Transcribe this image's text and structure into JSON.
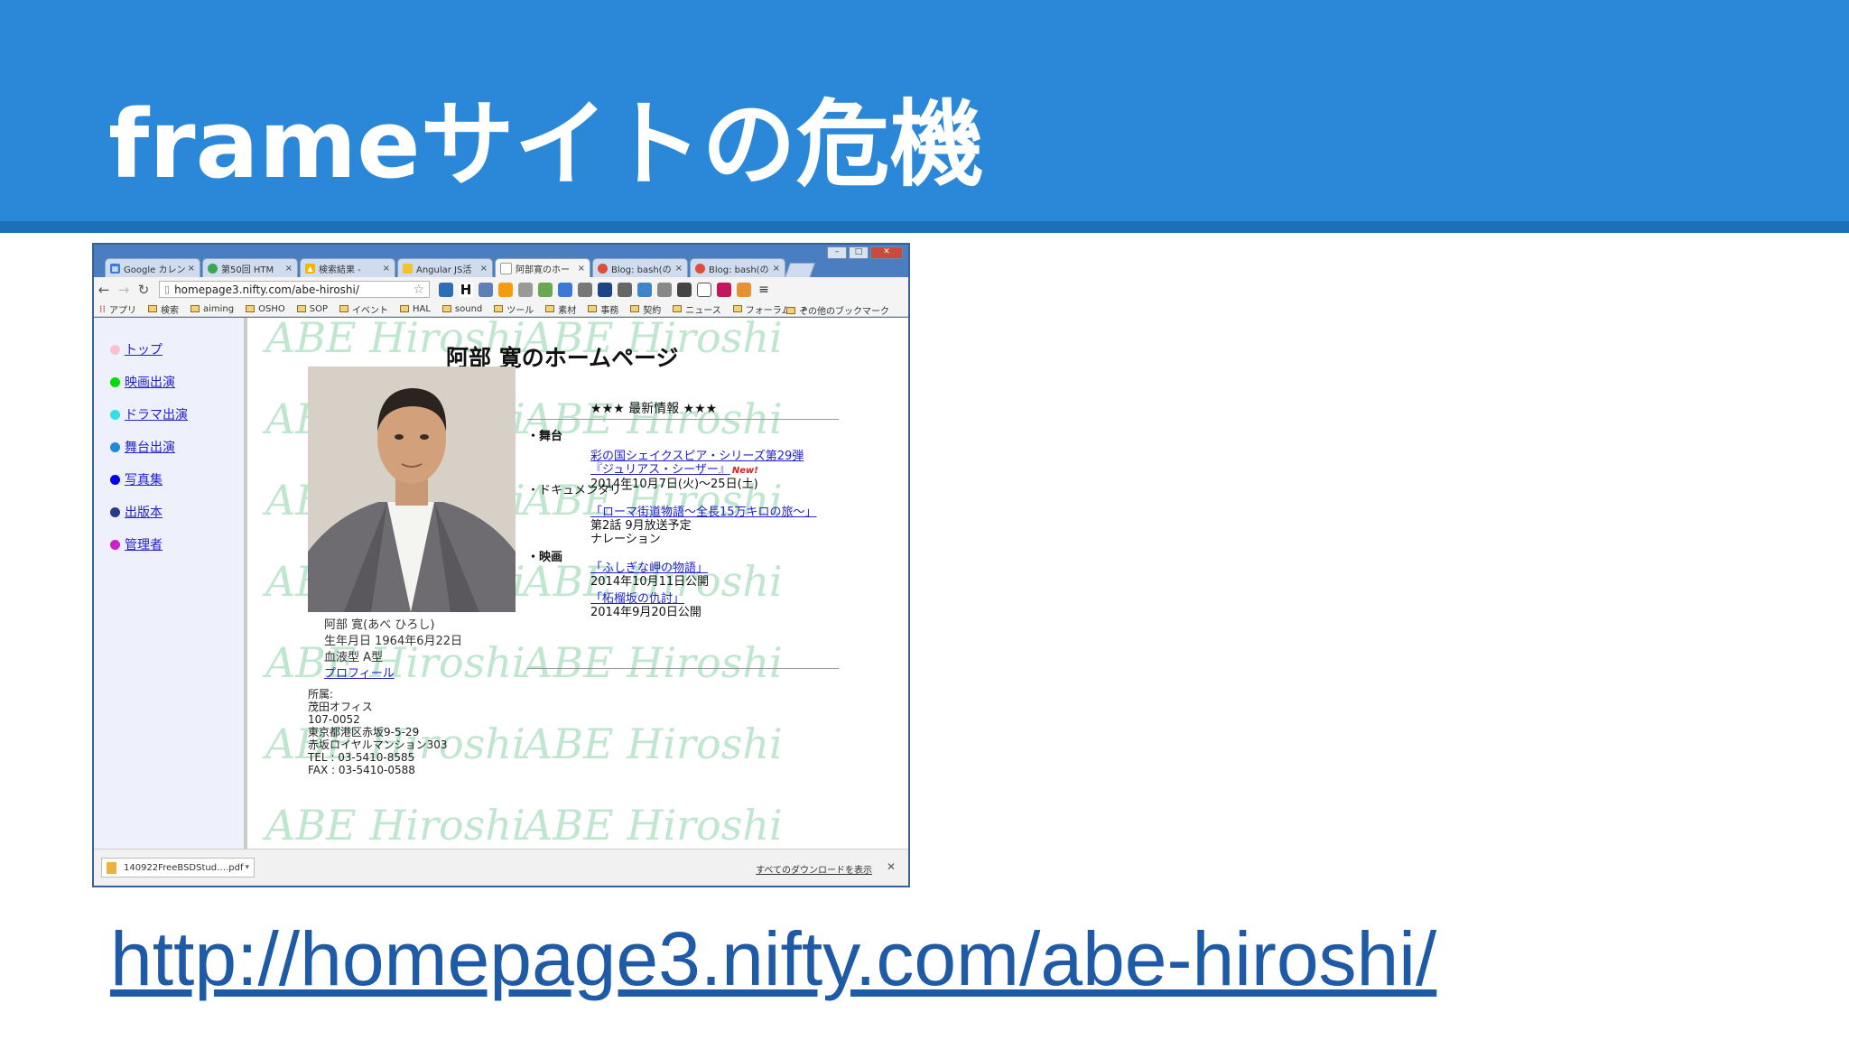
{
  "slide": {
    "title": "frameサイトの危機",
    "url": "http://homepage3.nifty.com/abe-hiroshi/",
    "header_color": "#2b88d9",
    "url_color": "#1f5aa6"
  },
  "browser": {
    "tabs": [
      {
        "title": "Google カレン",
        "icon": "calendar-icon",
        "active": false
      },
      {
        "title": "第50回 HTM",
        "icon": "circle-icon",
        "active": false
      },
      {
        "title": "検索結果 - ",
        "icon": "drive-icon",
        "active": false
      },
      {
        "title": "Angular JS活",
        "icon": "folder-icon",
        "active": false
      },
      {
        "title": "阿部寛のホー",
        "icon": "page-icon",
        "active": true
      },
      {
        "title": "Blog: bash(の",
        "icon": "blog-icon",
        "active": false
      },
      {
        "title": "Blog: bash(の",
        "icon": "blog-icon",
        "active": false
      }
    ],
    "address": "homepage3.nifty.com/abe-hiroshi/",
    "bookmarks": [
      "アプリ",
      "検索",
      "aiming",
      "OSHO",
      "SOP",
      "イベント",
      "HAL",
      "sound",
      "ツール",
      "素材",
      "事務",
      "契約",
      "ニュース",
      "フォーラム",
      "»"
    ],
    "other_bookmarks": "その他のブックマーク",
    "download": {
      "file": "140922FreeBSDStud….pdf",
      "show_all": "すべてのダウンロードを表示"
    }
  },
  "page": {
    "title": "阿部 寛のホームページ",
    "watermark": "ABE Hiroshi",
    "menu": [
      {
        "label": "トップ",
        "color": "#ffc0cb"
      },
      {
        "label": "映画出演",
        "color": "#00dd00"
      },
      {
        "label": "ドラマ出演",
        "color": "#33e0e8"
      },
      {
        "label": "舞台出演",
        "color": "#1e8ad8"
      },
      {
        "label": "写真集",
        "color": "#0000ee"
      },
      {
        "label": "出版本",
        "color": "#2a3a8a"
      },
      {
        "label": "管理者",
        "color": "#cc22cc"
      }
    ],
    "profile": {
      "name": "阿部 寛(あべ ひろし)",
      "birthday": "生年月日 1964年6月22日",
      "blood": "血液型 A型",
      "link": "プロフィール"
    },
    "address_lines": [
      "所属:",
      "茂田オフィス",
      "107-0052",
      "東京都港区赤坂9-5-29",
      "赤坂ロイヤルマンション303",
      "TEL : 03-5410-8585",
      "FAX : 03-5410-0588"
    ],
    "news_title": "★★★ 最新情報 ★★★",
    "sections": {
      "stage": {
        "label": "・舞台",
        "link1": "彩の国シェイクスピア・シリーズ第29弾",
        "link2": "『ジュリアス・シーザー』",
        "badge": "New!",
        "date": "2014年10月7日(火)～25日(土)"
      },
      "doc": {
        "label": "・ドキュメンタリー",
        "link": "「ローマ街道物語～全長15万キロの旅～」",
        "line1": "第2話 9月放送予定",
        "line2": "ナレーション"
      },
      "movie": {
        "label": "・映画",
        "link1": "「ふしぎな岬の物語」",
        "date1": "2014年10月11日公開",
        "link2": "「柘榴坂の仇討」",
        "date2": "2014年9月20日公開"
      }
    }
  }
}
